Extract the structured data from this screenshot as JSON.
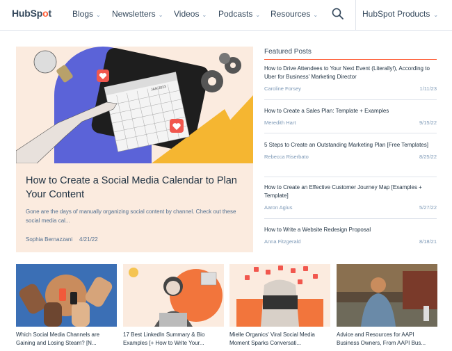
{
  "header": {
    "logo_text": "HubSpot",
    "nav": [
      {
        "label": "Blogs"
      },
      {
        "label": "Newsletters"
      },
      {
        "label": "Videos"
      },
      {
        "label": "Podcasts"
      },
      {
        "label": "Resources"
      }
    ],
    "products_label": "HubSpot Products",
    "chevron": "⌄"
  },
  "hero": {
    "title": "How to Create a Social Media Calendar to Plan Your Content",
    "description": "Gone are the days of manually organizing social content by channel. Check out these social media cal...",
    "author": "Sophia Bernazzani",
    "date": "4/21/22",
    "calendar_label": "JAN 2023"
  },
  "featured": {
    "heading": "Featured Posts",
    "posts": [
      {
        "title": "How to Drive Attendees to Your Next Event (Literally!), According to Uber for Business' Marketing Director",
        "author": "Caroline Forsey",
        "date": "1/11/23"
      },
      {
        "title": "How to Create a Sales Plan: Template + Examples",
        "author": "Meredith Hart",
        "date": "9/15/22"
      },
      {
        "title": "5 Steps to Create an Outstanding Marketing Plan [Free Templates]",
        "author": "Rebecca Riserbato",
        "date": "8/25/22"
      },
      {
        "title": "How to Create an Effective Customer Journey Map [Examples + Template]",
        "author": "Aaron Agius",
        "date": "5/27/22"
      },
      {
        "title": "How to Write a Website Redesign Proposal",
        "author": "Anna Fitzgerald",
        "date": "8/18/21"
      }
    ]
  },
  "cards": [
    {
      "title": "Which Social Media Channels are Gaining and Losing Steam? [N..."
    },
    {
      "title": "17 Best LinkedIn Summary & Bio Examples [+ How to Write Your..."
    },
    {
      "title": "Mielle Organics' Viral Social Media Moment Sparks Conversati..."
    },
    {
      "title": "Advice and Resources for AAPI Business Owners, From AAPI Bus..."
    }
  ],
  "colors": {
    "accent": "#ff5c35",
    "text": "#33475b",
    "hero_bg": "#fbebdf"
  }
}
